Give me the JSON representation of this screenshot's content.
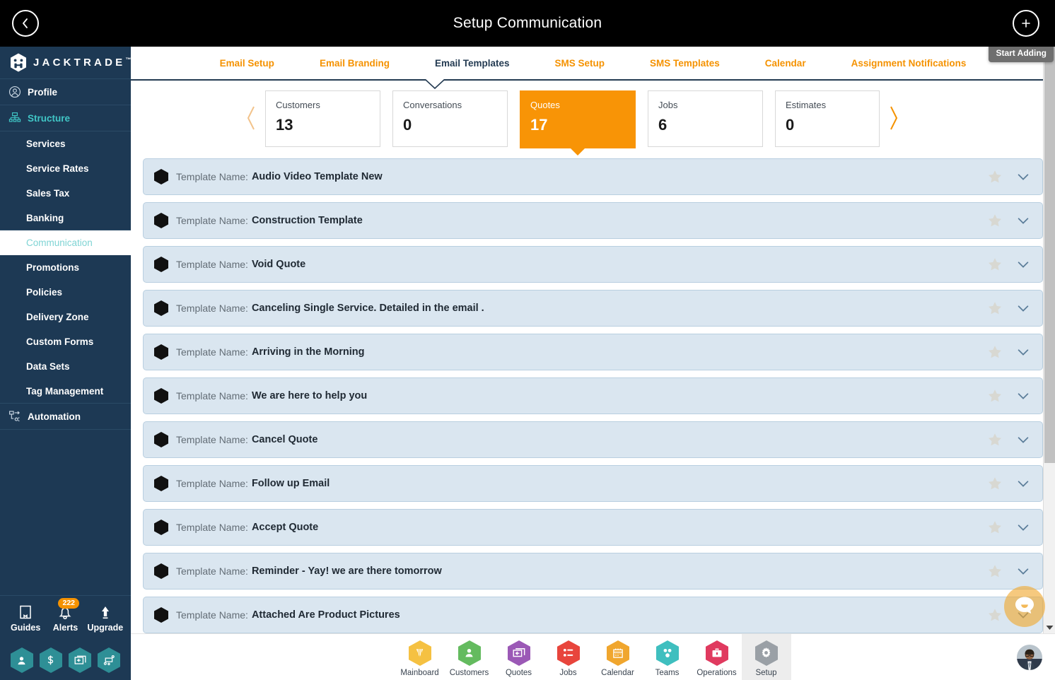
{
  "titlebar": {
    "title": "Setup Communication",
    "back_icon": "chevron-left-icon",
    "add_icon": "plus-icon"
  },
  "brand": {
    "name": "JACKTRADE",
    "trademark": "™",
    "logo_icon": "jacktrade-hex-logo"
  },
  "sidebar": {
    "items": [
      {
        "label": "Profile",
        "icon": "user-circle-icon",
        "type": "group",
        "state": "default"
      },
      {
        "label": "Structure",
        "icon": "org-chart-icon",
        "type": "group",
        "state": "accent"
      },
      {
        "label": "Services",
        "type": "sub",
        "state": "default"
      },
      {
        "label": "Service Rates",
        "type": "sub",
        "state": "default"
      },
      {
        "label": "Sales Tax",
        "type": "sub",
        "state": "default"
      },
      {
        "label": "Banking",
        "type": "sub",
        "state": "default"
      },
      {
        "label": "Communication",
        "type": "sub",
        "state": "active"
      },
      {
        "label": "Promotions",
        "type": "sub",
        "state": "default"
      },
      {
        "label": "Policies",
        "type": "sub",
        "state": "default"
      },
      {
        "label": "Delivery Zone",
        "type": "sub",
        "state": "default"
      },
      {
        "label": "Custom Forms",
        "type": "sub",
        "state": "default"
      },
      {
        "label": "Data Sets",
        "type": "sub",
        "state": "default"
      },
      {
        "label": "Tag Management",
        "type": "sub",
        "state": "default"
      },
      {
        "label": "Automation",
        "icon": "automation-flow-icon",
        "type": "group",
        "state": "default"
      }
    ],
    "footer": [
      {
        "label": "Guides",
        "icon": "book-icon",
        "badge": ""
      },
      {
        "label": "Alerts",
        "icon": "bell-icon",
        "badge": "222"
      },
      {
        "label": "Upgrade",
        "icon": "arrow-up-icon",
        "badge": ""
      }
    ],
    "quick_hexes": [
      {
        "icon": "person-icon"
      },
      {
        "icon": "dollar-icon"
      },
      {
        "icon": "quote-card-icon"
      },
      {
        "icon": "workflow-icon"
      }
    ],
    "badge_color": "#f59200",
    "background": "#1d3954",
    "accent": "#40c6c6"
  },
  "tabs": [
    {
      "label": "Email Setup",
      "active": false
    },
    {
      "label": "Email Branding",
      "active": false
    },
    {
      "label": "Email Templates",
      "active": true
    },
    {
      "label": "SMS Setup",
      "active": false
    },
    {
      "label": "SMS Templates",
      "active": false
    },
    {
      "label": "Calendar",
      "active": false
    },
    {
      "label": "Assignment Notifications",
      "active": false
    }
  ],
  "tooltip": {
    "text": "Start Adding"
  },
  "metrics": {
    "prev_icon": "chevron-left-icon",
    "next_icon": "chevron-right-icon",
    "cards": [
      {
        "label": "Customers",
        "value": "13",
        "selected": false
      },
      {
        "label": "Conversations",
        "value": "0",
        "selected": false
      },
      {
        "label": "Quotes",
        "value": "17",
        "selected": true
      },
      {
        "label": "Jobs",
        "value": "6",
        "selected": false
      },
      {
        "label": "Estimates",
        "value": "0",
        "selected": false
      }
    ],
    "selected_color": "#f89406"
  },
  "list": {
    "label_prefix": "Template Name:",
    "star_icon": "star-icon",
    "expand_icon": "chevron-down-icon",
    "bullet_icon": "hexagon-bullet-icon",
    "rows": [
      {
        "name": "Audio Video Template New"
      },
      {
        "name": "Construction Template"
      },
      {
        "name": "Void Quote"
      },
      {
        "name": "Canceling Single Service. Detailed in the email ."
      },
      {
        "name": "Arriving in the Morning"
      },
      {
        "name": "We are here to help you"
      },
      {
        "name": "Cancel Quote"
      },
      {
        "name": "Follow up Email"
      },
      {
        "name": "Accept Quote"
      },
      {
        "name": "Reminder - Yay! we are there tomorrow"
      },
      {
        "name": "Attached Are Product Pictures"
      }
    ]
  },
  "chat": {
    "icon": "chat-bubble-icon"
  },
  "bottomnav": {
    "items": [
      {
        "label": "Mainboard",
        "icon": "mainboard-icon",
        "color": "#f5c142",
        "active": false
      },
      {
        "label": "Customers",
        "icon": "person-icon",
        "color": "#64bb5f",
        "active": false
      },
      {
        "label": "Quotes",
        "icon": "quote-card-icon",
        "color": "#9b59b6",
        "active": false
      },
      {
        "label": "Jobs",
        "icon": "list-icon",
        "color": "#e8453c",
        "active": false
      },
      {
        "label": "Calendar",
        "icon": "calendar-icon",
        "color": "#f0a62e",
        "active": false
      },
      {
        "label": "Teams",
        "icon": "teams-icon",
        "color": "#3fbfbf",
        "active": false
      },
      {
        "label": "Operations",
        "icon": "briefcase-icon",
        "color": "#e03a5f",
        "active": false
      },
      {
        "label": "Setup",
        "icon": "gear-icon",
        "color": "#9aa0a6",
        "active": true
      }
    ],
    "avatar_icon": "user-avatar"
  },
  "scrollbar": {
    "thumb_icon": "scrollbar-thumb",
    "down_arrow_icon": "caret-down-icon"
  }
}
